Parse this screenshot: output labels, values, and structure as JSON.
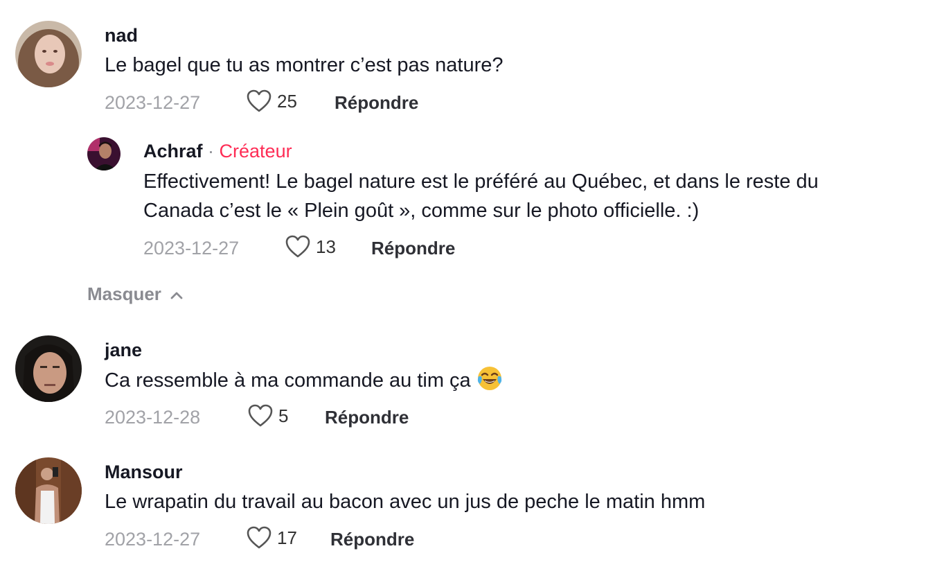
{
  "comments": [
    {
      "username": "nad",
      "text": "Le bagel que tu as montrer c’est pas nature?",
      "date": "2023-12-27",
      "likes": "25",
      "reply_label": "Répondre",
      "avatar_icon": "avatar-photo-woman"
    },
    {
      "username": "jane",
      "text": "Ca ressemble à ma commande au tim ça",
      "emoji": "face-with-tears-of-joy-icon",
      "date": "2023-12-28",
      "likes": "5",
      "reply_label": "Répondre",
      "avatar_icon": "avatar-photo-man"
    },
    {
      "username": "Mansour",
      "text": "Le wrapatin du travail au bacon avec un jus de peche le matin hmm",
      "date": "2023-12-27",
      "likes": "17",
      "reply_label": "Répondre",
      "avatar_icon": "avatar-photo-mirror-selfie"
    }
  ],
  "reply": {
    "username": "Achraf",
    "separator": " · ",
    "badge": "Créateur",
    "text_line1": "Effectivement! Le bagel nature est le préféré au Québec, et dans le reste du",
    "text_line2": "Canada c’est le « Plein goût », comme sur le photo officielle. :)",
    "date": "2023-12-27",
    "likes": "13",
    "reply_label": "Répondre",
    "avatar_icon": "avatar-photo-creator"
  },
  "hide_replies": {
    "label": "Masquer",
    "icon": "chevron-up-icon"
  },
  "colors": {
    "text": "#161823",
    "secondary": "#a1a2a7",
    "creator_accent": "#fe2c55",
    "reply_action": "#2f3036"
  }
}
